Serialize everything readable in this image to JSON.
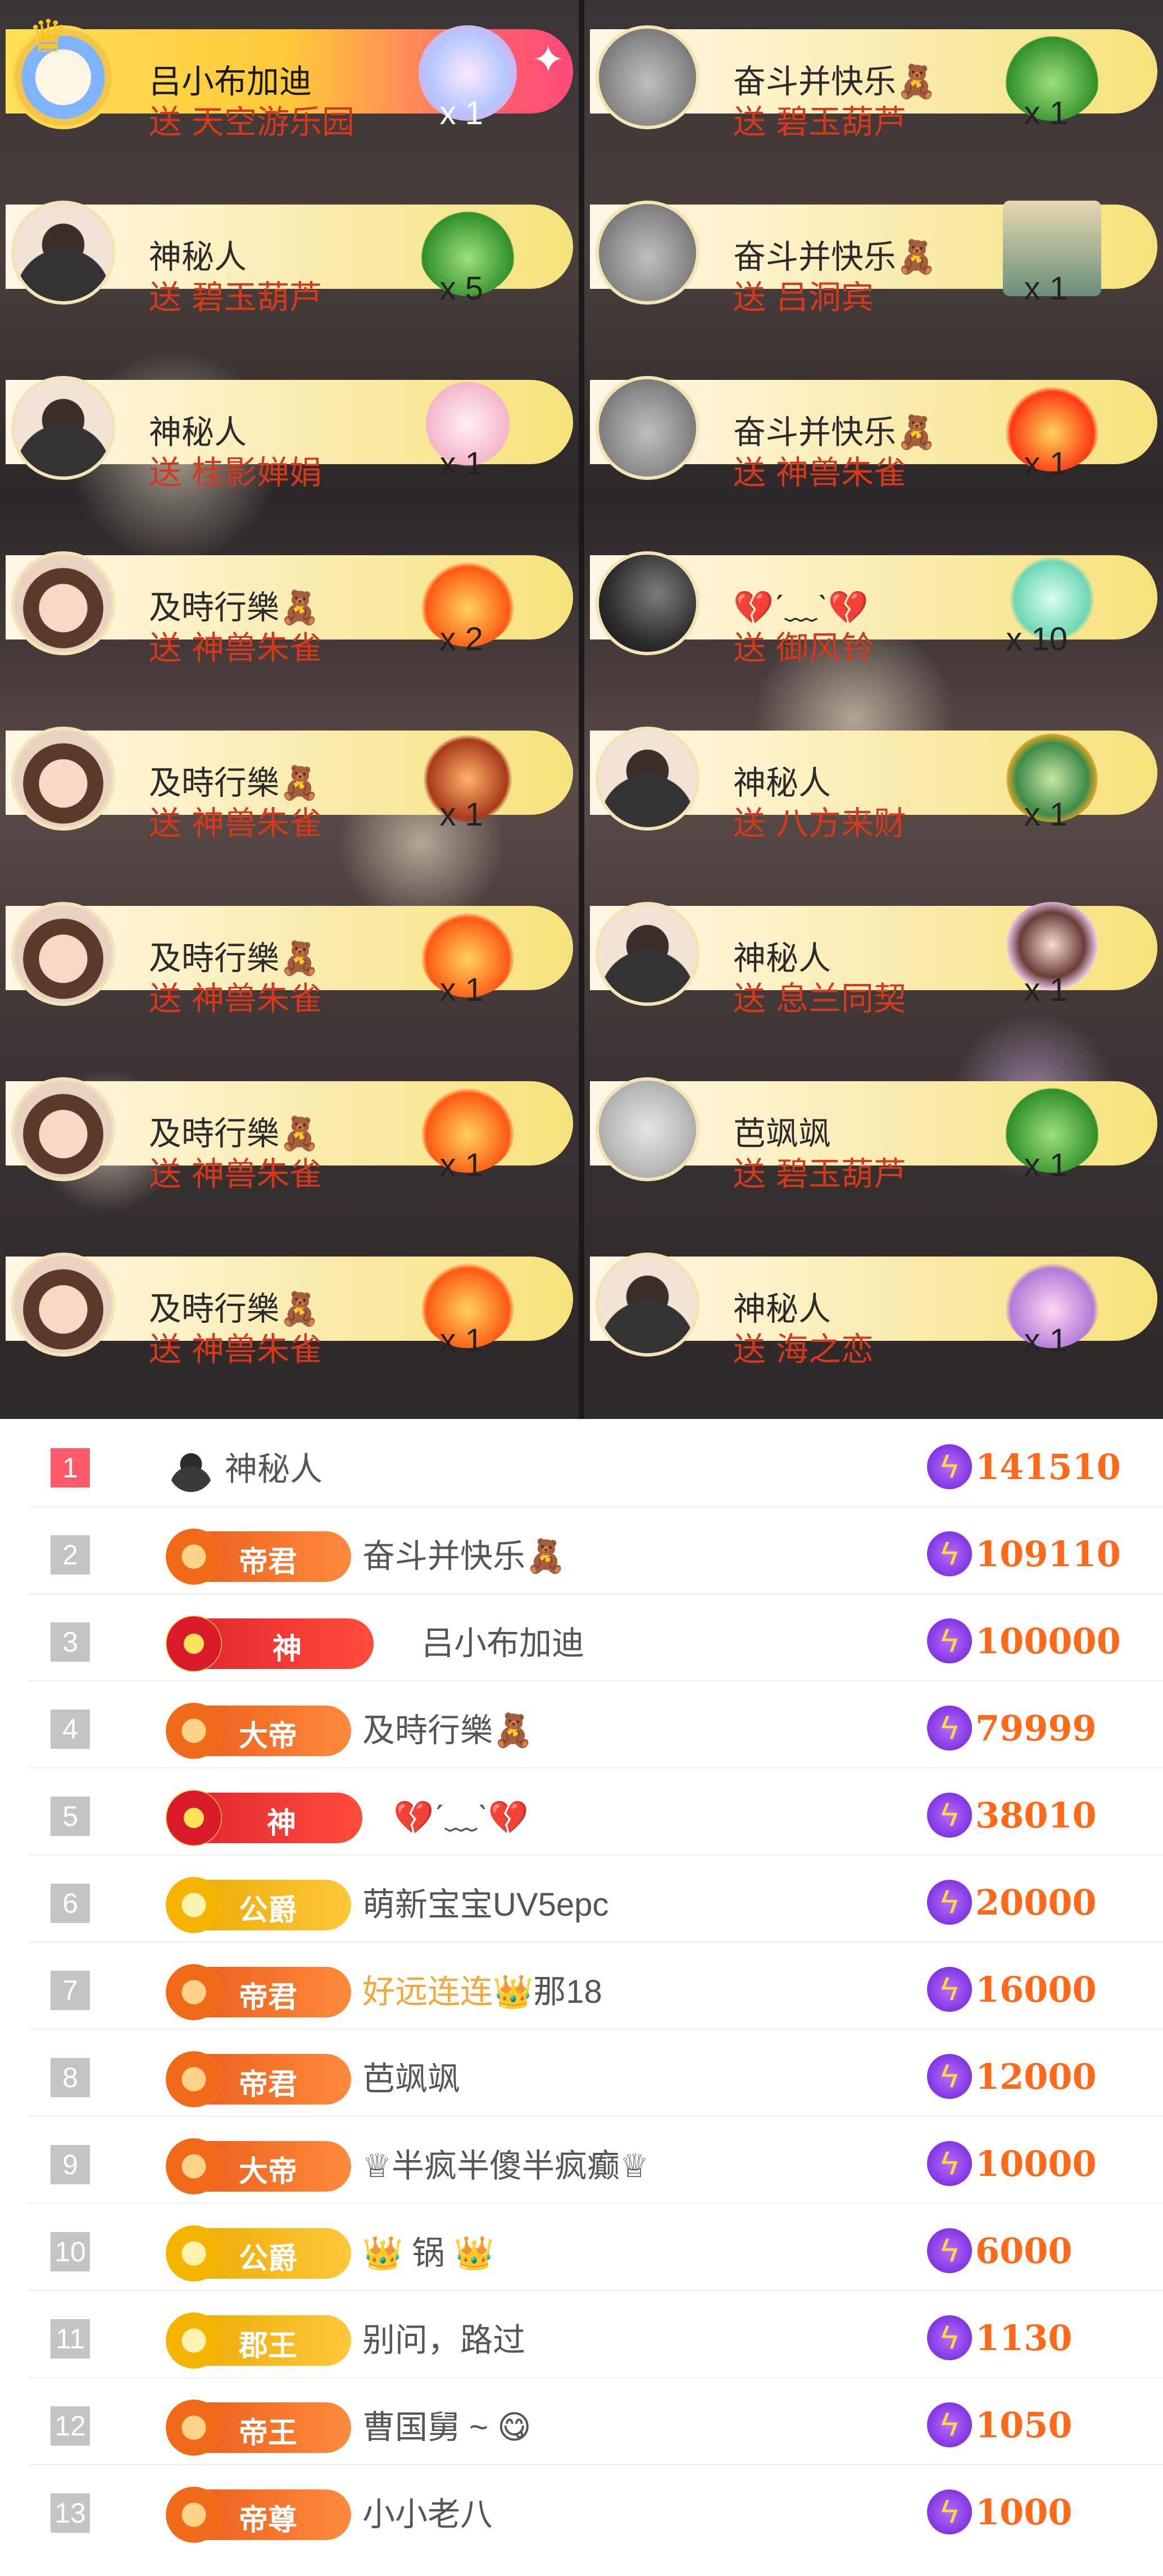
{
  "gift_feed": {
    "left": [
      {
        "user": "吕小布加迪",
        "verb": "送",
        "gift": "天空游乐园",
        "count": "x 1",
        "avatar": "crowned-avatar",
        "highlight": true
      },
      {
        "user": "神秘人",
        "verb": "送",
        "gift": "碧玉葫芦",
        "count": "x 5",
        "avatar": "mystery-avatar"
      },
      {
        "user": "神秘人",
        "verb": "送",
        "gift": "桂影婵娟",
        "count": "x 1",
        "avatar": "mystery-avatar"
      },
      {
        "user": "及時行樂🧸",
        "verb": "送",
        "gift": "神兽朱雀",
        "count": "x 2",
        "avatar": "girl-avatar"
      },
      {
        "user": "及時行樂🧸",
        "verb": "送",
        "gift": "神兽朱雀",
        "count": "x 1",
        "avatar": "girl-avatar"
      },
      {
        "user": "及時行樂🧸",
        "verb": "送",
        "gift": "神兽朱雀",
        "count": "x 1",
        "avatar": "girl-avatar"
      },
      {
        "user": "及時行樂🧸",
        "verb": "送",
        "gift": "神兽朱雀",
        "count": "x 1",
        "avatar": "girl-avatar"
      },
      {
        "user": "及時行樂🧸",
        "verb": "送",
        "gift": "神兽朱雀",
        "count": "x 1",
        "avatar": "girl-avatar"
      }
    ],
    "right": [
      {
        "user": "奋斗并快乐🧸",
        "verb": "送",
        "gift": "碧玉葫芦",
        "count": "x 1",
        "avatar": "mist-avatar"
      },
      {
        "user": "奋斗并快乐🧸",
        "verb": "送",
        "gift": "吕洞宾",
        "count": "x 1",
        "avatar": "mist-avatar"
      },
      {
        "user": "奋斗并快乐🧸",
        "verb": "送",
        "gift": "神兽朱雀",
        "count": "x 1",
        "avatar": "mist-avatar"
      },
      {
        "user": "💔ˊ﹏ˋ💔",
        "verb": "送",
        "gift": "御风铃",
        "count": "x 10",
        "avatar": "dark-avatar"
      },
      {
        "user": "神秘人",
        "verb": "送",
        "gift": "八方来财",
        "count": "x 1",
        "avatar": "mystery-avatar"
      },
      {
        "user": "神秘人",
        "verb": "送",
        "gift": "息兰同契",
        "count": "x 1",
        "avatar": "mystery-avatar"
      },
      {
        "user": "芭飒飒",
        "verb": "送",
        "gift": "碧玉葫芦",
        "count": "x 1",
        "avatar": "walker-avatar"
      },
      {
        "user": "神秘人",
        "verb": "送",
        "gift": "海之恋",
        "count": "x 1",
        "avatar": "mystery-avatar"
      }
    ]
  },
  "ranking": [
    {
      "rank": "1",
      "badge": "",
      "name": "神秘人",
      "score": "141510",
      "icon": "mystery-icon"
    },
    {
      "rank": "2",
      "badge": "帝君",
      "name": "奋斗并快乐🧸",
      "score": "109110"
    },
    {
      "rank": "3",
      "badge": "神",
      "name": "吕小布加迪",
      "score": "100000"
    },
    {
      "rank": "4",
      "badge": "大帝",
      "name": "及時行樂🧸",
      "score": "79999"
    },
    {
      "rank": "5",
      "badge": "神",
      "name": "💔ˊ﹏ˋ💔",
      "score": "38010"
    },
    {
      "rank": "6",
      "badge": "公爵",
      "name": "萌新宝宝UV5epc",
      "score": "20000"
    },
    {
      "rank": "7",
      "badge": "帝君",
      "name_part1": "好远连连",
      "name_part2": "👑",
      "name_part3": "那18",
      "score": "16000"
    },
    {
      "rank": "8",
      "badge": "帝君",
      "name": "芭飒飒",
      "score": "12000"
    },
    {
      "rank": "9",
      "badge": "大帝",
      "name": "♕半疯半傻半疯癫♕",
      "score": "10000"
    },
    {
      "rank": "10",
      "badge": "公爵",
      "name": "👑 锅 👑",
      "score": "6000"
    },
    {
      "rank": "11",
      "badge": "郡王",
      "name": "别问，路过",
      "score": "1130"
    },
    {
      "rank": "12",
      "badge": "帝王",
      "name": "曹国舅 ~ 😋",
      "score": "1050"
    },
    {
      "rank": "13",
      "badge": "帝尊",
      "name": "小小老八",
      "score": "1000"
    }
  ],
  "icons": {
    "score": "lightning-icon"
  },
  "colors": {
    "gift_text": "#d6381c",
    "score": "#ff6a1a",
    "rank1": "#ff5a6a"
  }
}
